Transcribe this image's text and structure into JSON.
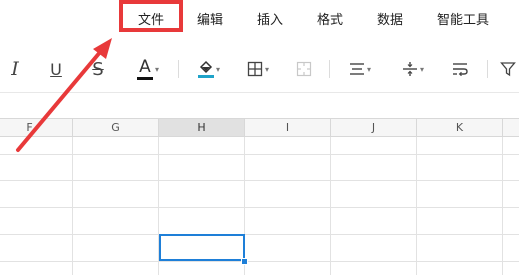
{
  "menu": {
    "items": [
      "文件",
      "编辑",
      "插入",
      "格式",
      "数据",
      "智能工具"
    ]
  },
  "columns": [
    "F",
    "G",
    "H",
    "I",
    "J",
    "K"
  ],
  "selected_column": "H",
  "colors": {
    "highlight": "#e8393a",
    "arrow": "#e8393a",
    "selection": "#1e7fd8",
    "font_color_bar": "#111111",
    "fill_color_bar": "#1fa3c9"
  },
  "toolbar": {
    "icons": [
      "italic-icon",
      "underline-icon",
      "strikethrough-icon",
      "font-color-icon",
      "fill-color-icon",
      "borders-icon",
      "merge-cells-icon",
      "horizontal-align-icon",
      "vertical-align-icon",
      "wrap-text-icon",
      "filter-icon"
    ],
    "italic_glyph": "I",
    "underline_glyph": "U",
    "strike_glyph": "S",
    "font_color_glyph": "A"
  }
}
